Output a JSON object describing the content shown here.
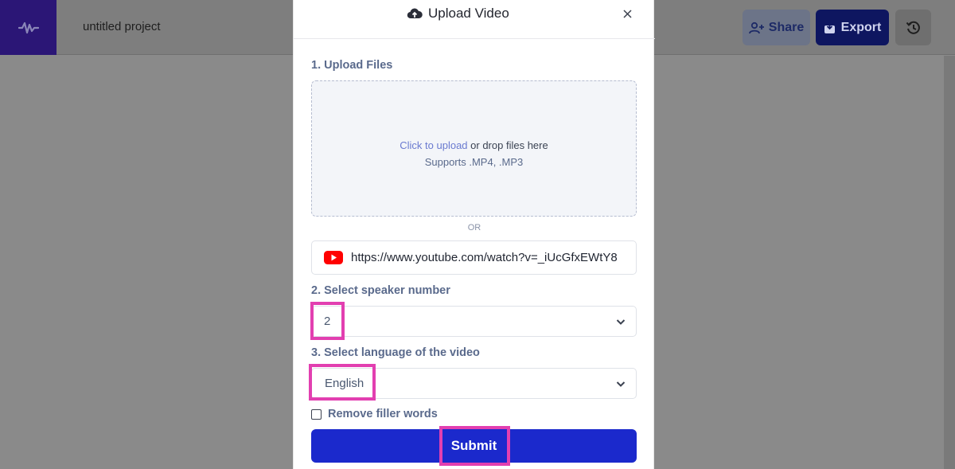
{
  "app": {
    "project_name": "untitled project",
    "share_label": "Share",
    "export_label": "Export"
  },
  "modal": {
    "title": "Upload Video",
    "step1_label": "1. Upload Files",
    "dropzone": {
      "link_text": "Click to upload",
      "rest_text": " or drop files here",
      "formats": "Supports .MP4, .MP3"
    },
    "or_text": "OR",
    "youtube_url": "https://www.youtube.com/watch?v=_iUcGfxEWtY8",
    "step2_label": "2. Select speaker number",
    "speaker_number": "2",
    "step3_label": "3. Select language of the video",
    "language": "English",
    "filler_label": "Remove filler words",
    "filler_checked": false,
    "submit_label": "Submit"
  },
  "colors": {
    "brand": "#1b29cc",
    "highlight": "#e23fb0",
    "youtube_red": "#ff0000"
  },
  "icons": [
    "waveform-logo-icon",
    "share-user-icon",
    "export-icon",
    "history-icon",
    "cloud-upload-icon",
    "close-icon",
    "youtube-icon",
    "chevron-down-icon"
  ]
}
